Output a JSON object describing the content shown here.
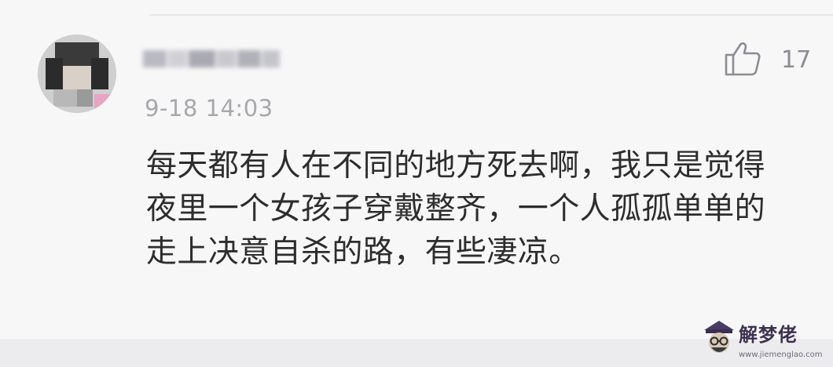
{
  "comment": {
    "avatar_icon": "avatar-icon",
    "username": "",
    "timestamp": "9-18 14:03",
    "like_icon": "thumbs-up-icon",
    "like_count": "17",
    "body_lines": [
      "每天都有人在不同的地方死去啊，我只是觉得",
      "夜里一个女孩子穿戴整齐，一个人孤孤单单的",
      "走上决意自杀的路，有些凄凉。"
    ]
  },
  "watermark": {
    "name": "解梦佬",
    "url": "www.jiemenglao.com"
  },
  "colors": {
    "background": "#f7f7f8",
    "text": "#2d2d2d",
    "meta": "#a7a7ac",
    "icon": "#8c8c92"
  }
}
